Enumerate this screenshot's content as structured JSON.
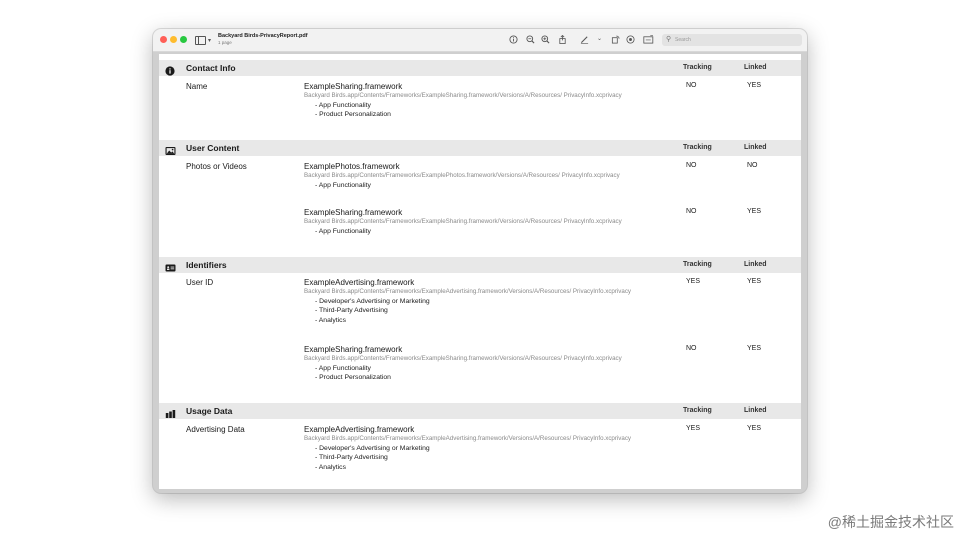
{
  "window": {
    "doc_title": "Backyard Birds-PrivacyReport.pdf",
    "doc_subtitle": "1 page",
    "search_placeholder": "Search",
    "toolbar_icons": [
      "info-icon",
      "zoom-out-icon",
      "zoom-in-icon",
      "share-icon",
      "markup-icon",
      "chevron-down-icon",
      "rotate-icon",
      "highlight-icon",
      "form-icon"
    ]
  },
  "columns": {
    "tracking": "Tracking",
    "linked": "Linked"
  },
  "sections": [
    {
      "title": "Contact Info",
      "icon": "info-circle-icon",
      "rows": [
        {
          "label": "Name",
          "entries": [
            {
              "framework": "ExampleSharing.framework",
              "path": "Backyard Birds.app/Contents/Frameworks/ExampleSharing.framework/Versions/A/Resources/ PrivacyInfo.xcprivacy",
              "reasons": [
                "- App Functionality",
                "- Product Personalization"
              ],
              "tracking": "NO",
              "linked": "YES"
            }
          ]
        }
      ]
    },
    {
      "title": "User Content",
      "icon": "photo-icon",
      "rows": [
        {
          "label": "Photos or Videos",
          "entries": [
            {
              "framework": "ExamplePhotos.framework",
              "path": "Backyard Birds.app/Contents/Frameworks/ExamplePhotos.framework/Versions/A/Resources/ PrivacyInfo.xcprivacy",
              "reasons": [
                "- App Functionality"
              ],
              "tracking": "NO",
              "linked": "NO"
            },
            {
              "framework": "ExampleSharing.framework",
              "path": "Backyard Birds.app/Contents/Frameworks/ExampleSharing.framework/Versions/A/Resources/ PrivacyInfo.xcprivacy",
              "reasons": [
                "- App Functionality"
              ],
              "tracking": "NO",
              "linked": "YES"
            }
          ]
        }
      ]
    },
    {
      "title": "Identifiers",
      "icon": "id-card-icon",
      "rows": [
        {
          "label": "User ID",
          "entries": [
            {
              "framework": "ExampleAdvertising.framework",
              "path": "Backyard Birds.app/Contents/Frameworks/ExampleAdvertising.framework/Versions/A/Resources/ PrivacyInfo.xcprivacy",
              "reasons": [
                "- Developer's Advertising or Marketing",
                "- Third-Party Advertising",
                "- Analytics"
              ],
              "tracking": "YES",
              "linked": "YES"
            },
            {
              "framework": "ExampleSharing.framework",
              "path": "Backyard Birds.app/Contents/Frameworks/ExampleSharing.framework/Versions/A/Resources/ PrivacyInfo.xcprivacy",
              "reasons": [
                "- App Functionality",
                "- Product Personalization"
              ],
              "tracking": "NO",
              "linked": "YES"
            }
          ]
        }
      ]
    },
    {
      "title": "Usage Data",
      "icon": "bar-chart-icon",
      "rows": [
        {
          "label": "Advertising Data",
          "entries": [
            {
              "framework": "ExampleAdvertising.framework",
              "path": "Backyard Birds.app/Contents/Frameworks/ExampleAdvertising.framework/Versions/A/Resources/ PrivacyInfo.xcprivacy",
              "reasons": [
                "- Developer's Advertising or Marketing",
                "- Third-Party Advertising",
                "- Analytics"
              ],
              "tracking": "YES",
              "linked": "YES"
            }
          ]
        }
      ]
    }
  ],
  "watermark": "@稀土掘金技术社区"
}
